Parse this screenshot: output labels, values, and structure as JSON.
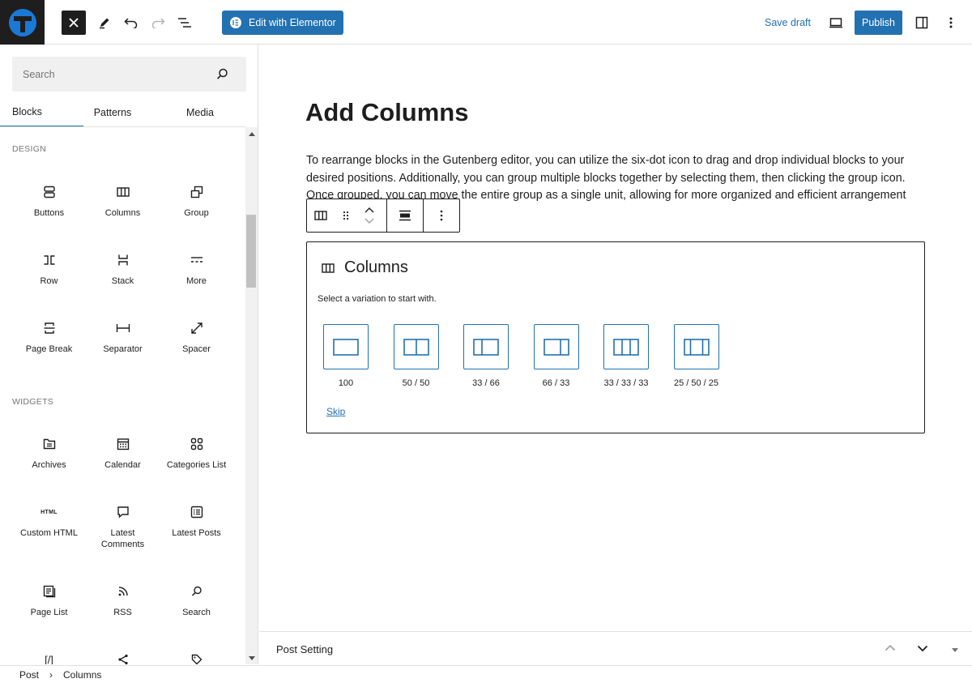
{
  "toolbar": {
    "elementor_label": "Edit with Elementor",
    "save_draft_label": "Save draft",
    "publish_label": "Publish"
  },
  "colors": {
    "accent": "#2271b1",
    "dark": "#1e1e1e",
    "muted": "#757575"
  },
  "sidebar": {
    "search_placeholder": "Search",
    "tabs": [
      {
        "label": "Blocks",
        "active": true
      },
      {
        "label": "Patterns",
        "active": false
      },
      {
        "label": "Media",
        "active": false
      }
    ],
    "sections": [
      {
        "heading": "DESIGN"
      },
      {
        "heading": "WIDGETS"
      }
    ],
    "design_blocks": [
      {
        "label": "Buttons",
        "icon": "buttons-icon"
      },
      {
        "label": "Columns",
        "icon": "columns-icon"
      },
      {
        "label": "Group",
        "icon": "group-icon"
      },
      {
        "label": "Row",
        "icon": "row-icon"
      },
      {
        "label": "Stack",
        "icon": "stack-icon"
      },
      {
        "label": "More",
        "icon": "more-icon"
      },
      {
        "label": "Page Break",
        "icon": "page-break-icon"
      },
      {
        "label": "Separator",
        "icon": "separator-icon"
      },
      {
        "label": "Spacer",
        "icon": "spacer-icon"
      }
    ],
    "widget_blocks": [
      {
        "label": "Archives",
        "icon": "archives-icon"
      },
      {
        "label": "Calendar",
        "icon": "calendar-icon"
      },
      {
        "label": "Categories List",
        "icon": "categories-icon"
      },
      {
        "label": "Custom HTML",
        "icon": "html-icon",
        "icon_text": "HTML"
      },
      {
        "label": "Latest Comments",
        "icon": "comment-icon"
      },
      {
        "label": "Latest Posts",
        "icon": "posts-icon"
      },
      {
        "label": "Page List",
        "icon": "page-list-icon"
      },
      {
        "label": "RSS",
        "icon": "rss-icon"
      },
      {
        "label": "Search",
        "icon": "search-icon"
      },
      {
        "label": "",
        "icon": "shortcode-icon",
        "icon_text": "[/]"
      },
      {
        "label": "",
        "icon": "share-icon"
      },
      {
        "label": "",
        "icon": "tag-icon"
      }
    ]
  },
  "editor": {
    "post_title": "Add Columns",
    "paragraph": "To rearrange blocks in the Gutenberg editor, you can utilize the six-dot icon to drag and drop individual blocks to your desired positions. Additionally, you can group multiple blocks together by selecting them, then clicking the group icon. Once grouped, you can move the entire group as a single unit, allowing for more organized and efficient arrangement",
    "columns_block": {
      "title": "Columns",
      "instruction": "Select a variation to start with.",
      "variations": [
        {
          "label": "100",
          "columns": [
            1
          ]
        },
        {
          "label": "50 / 50",
          "columns": [
            1,
            1
          ]
        },
        {
          "label": "33 / 66",
          "columns": [
            1,
            2
          ]
        },
        {
          "label": "66 / 33",
          "columns": [
            2,
            1
          ]
        },
        {
          "label": "33 / 33 / 33",
          "columns": [
            1,
            1,
            1
          ]
        },
        {
          "label": "25 / 50 / 25",
          "columns": [
            1,
            2,
            1
          ]
        }
      ],
      "skip_label": "Skip"
    }
  },
  "post_setting": {
    "title": "Post Setting"
  },
  "breadcrumb": {
    "items": [
      "Post",
      "Columns"
    ],
    "separator": "›"
  }
}
